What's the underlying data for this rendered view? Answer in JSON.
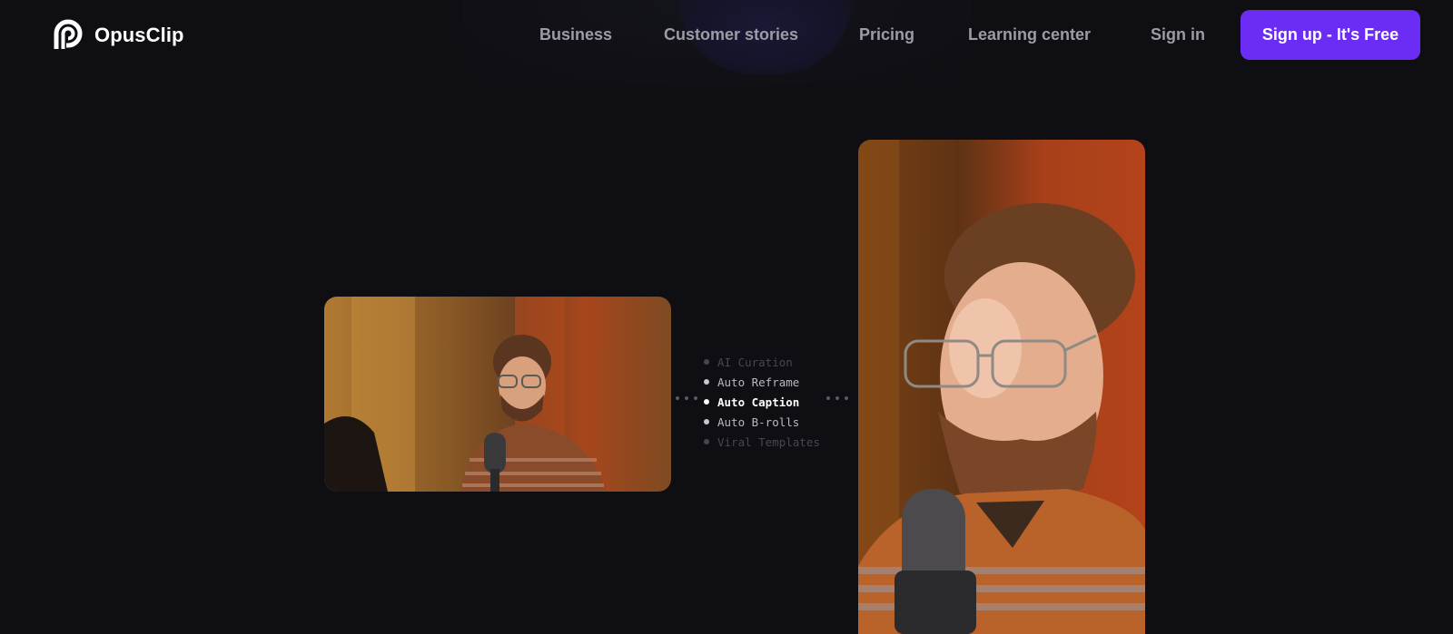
{
  "brand": {
    "name": "OpusClip",
    "logo_icon": "opusclip-logo-icon"
  },
  "nav": {
    "links": [
      {
        "label": "Business"
      },
      {
        "label": "Customer stories"
      },
      {
        "label": "Pricing"
      },
      {
        "label": "Learning center"
      },
      {
        "label": "Sign in"
      }
    ],
    "cta_label": "Sign up - It's Free"
  },
  "hero": {
    "source_video_icon": "landscape-video-thumbnail",
    "output_video_icon": "vertical-video-thumbnail",
    "features": [
      {
        "label": "AI Curation",
        "state": "faded"
      },
      {
        "label": "Auto Reframe",
        "state": "normal"
      },
      {
        "label": "Auto Caption",
        "state": "active"
      },
      {
        "label": "Auto B-rolls",
        "state": "normal"
      },
      {
        "label": "Viral Templates",
        "state": "faded"
      }
    ]
  },
  "colors": {
    "background": "#0e0e13",
    "accent": "#6b2cf5",
    "nav_text": "#9c9ca6"
  }
}
